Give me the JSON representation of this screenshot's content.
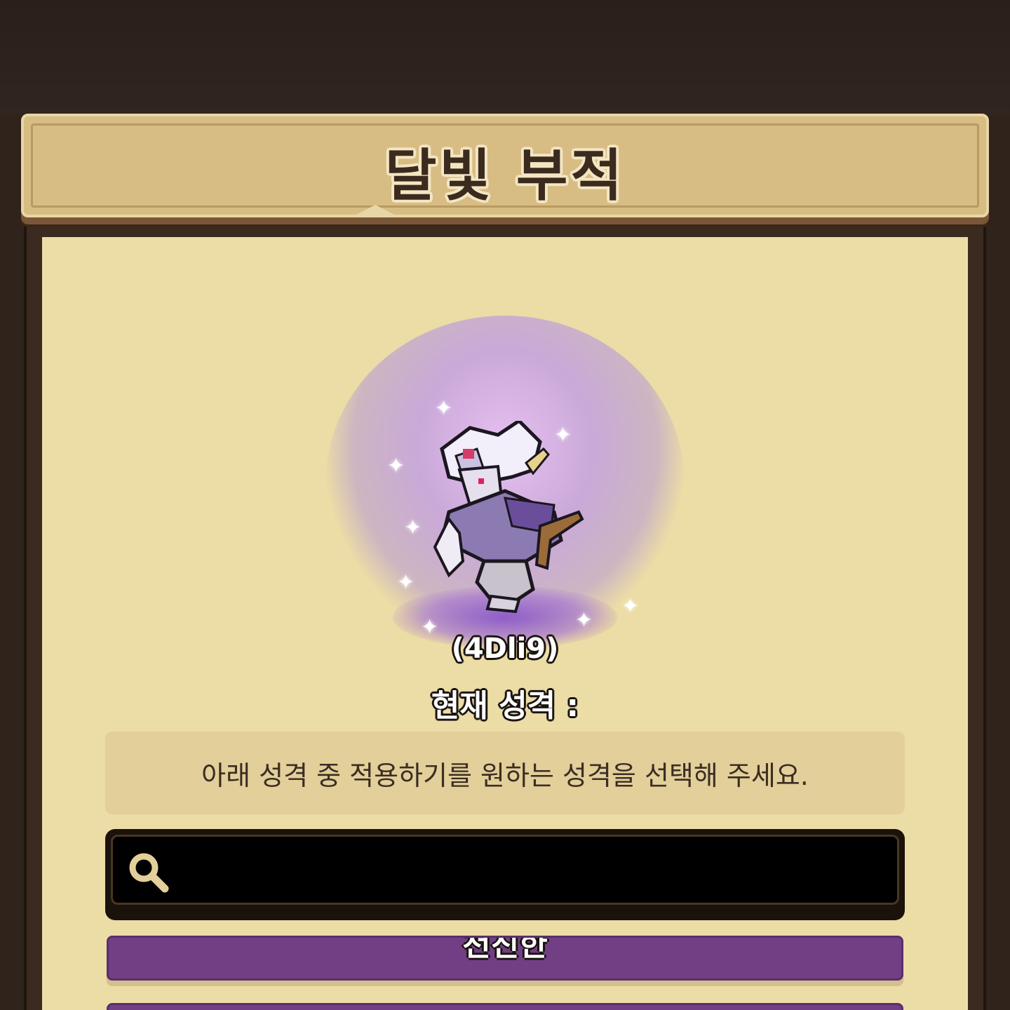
{
  "dialog": {
    "title": "달빛 부적"
  },
  "character": {
    "code": "(4Dli9)",
    "current_personality_label": "현재 성격 :"
  },
  "instruction": {
    "text": "아래 성격 중 적용하기를 원하는 성격을 선택해 주세요."
  },
  "search": {
    "value": "",
    "placeholder": "",
    "icon": "search-icon"
  },
  "options": [
    {
      "label": "천진한"
    },
    {
      "label": ""
    }
  ],
  "colors": {
    "background": "#2f231c",
    "panel": "#ecdca6",
    "title_bar": "#d7bc84",
    "option_purple": "#723f84",
    "glow": "#c8a0e6"
  }
}
